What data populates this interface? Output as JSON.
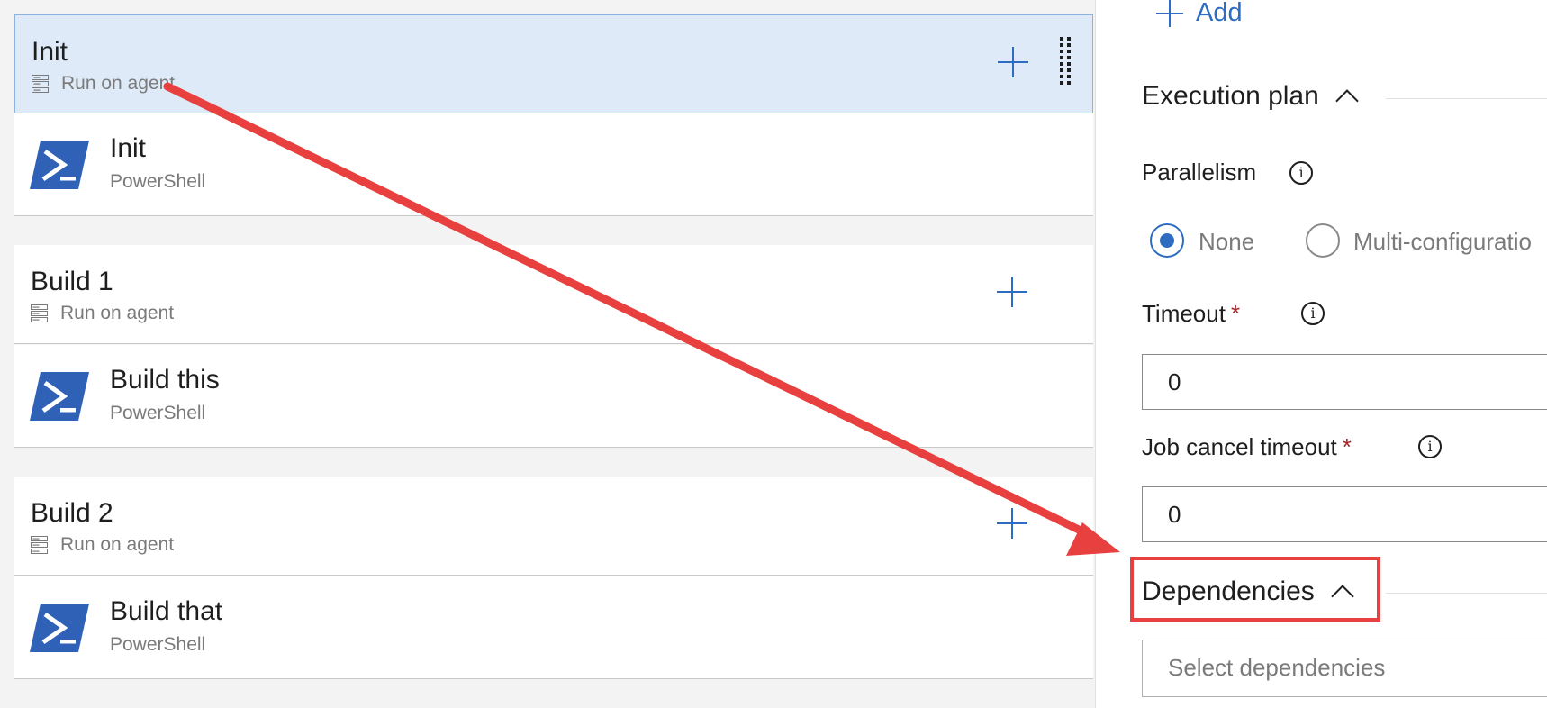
{
  "phases": [
    {
      "title": "Init",
      "subtitle": "Run on agent",
      "task": {
        "title": "Init",
        "subtitle": "PowerShell"
      }
    },
    {
      "title": "Build 1",
      "subtitle": "Run on agent",
      "task": {
        "title": "Build this",
        "subtitle": "PowerShell"
      }
    },
    {
      "title": "Build 2",
      "subtitle": "Run on agent",
      "task": {
        "title": "Build that",
        "subtitle": "PowerShell"
      }
    }
  ],
  "right_panel": {
    "add_label": "Add",
    "execution_plan": {
      "heading": "Execution plan",
      "parallelism_label": "Parallelism",
      "options": [
        "None",
        "Multi-configuratio"
      ],
      "selected_option": "None",
      "timeout_label": "Timeout",
      "timeout_value": "0",
      "job_cancel_timeout_label": "Job cancel timeout",
      "job_cancel_timeout_value": "0",
      "required_marker": "*"
    },
    "dependencies": {
      "heading": "Dependencies",
      "placeholder": "Select dependencies"
    }
  },
  "icons": {
    "info": "i"
  },
  "colors": {
    "accent": "#2d6cc0",
    "selected_row": "#dfeaf8",
    "annotation": "#e8403e",
    "powershell": "#2f62b7"
  }
}
